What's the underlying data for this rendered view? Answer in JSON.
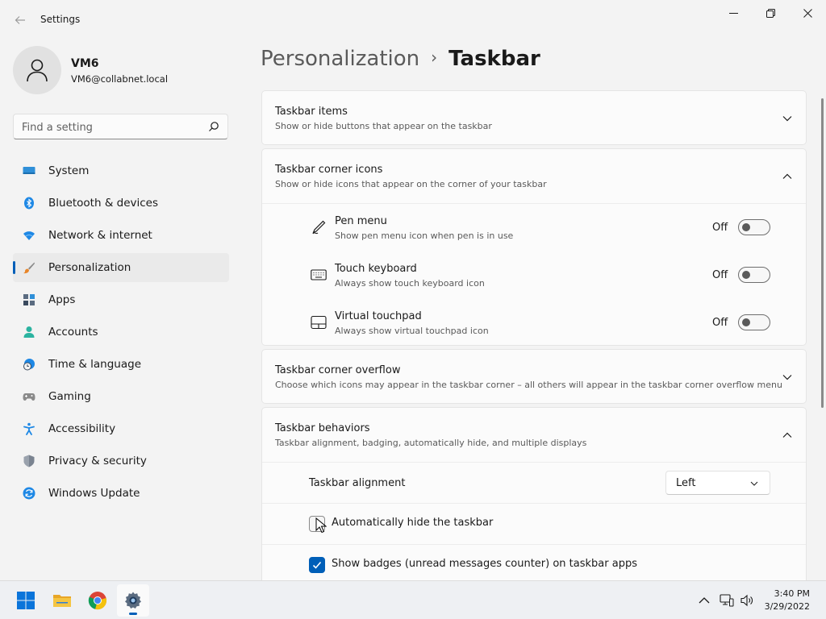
{
  "window": {
    "title": "Settings",
    "back_icon": "back-arrow-icon",
    "controls": [
      "minimize-icon",
      "restore-icon",
      "close-icon"
    ]
  },
  "profile": {
    "name": "VM6",
    "email": "VM6@collabnet.local"
  },
  "search": {
    "placeholder": "Find a setting",
    "value": ""
  },
  "sidebar": {
    "active": "Personalization",
    "items": [
      {
        "label": "System",
        "icon": "system-icon"
      },
      {
        "label": "Bluetooth & devices",
        "icon": "bluetooth-icon"
      },
      {
        "label": "Network & internet",
        "icon": "wifi-icon"
      },
      {
        "label": "Personalization",
        "icon": "brush-icon"
      },
      {
        "label": "Apps",
        "icon": "apps-icon"
      },
      {
        "label": "Accounts",
        "icon": "person-icon"
      },
      {
        "label": "Time & language",
        "icon": "clock-globe-icon"
      },
      {
        "label": "Gaming",
        "icon": "gamepad-icon"
      },
      {
        "label": "Accessibility",
        "icon": "accessibility-icon"
      },
      {
        "label": "Privacy & security",
        "icon": "shield-icon"
      },
      {
        "label": "Windows Update",
        "icon": "update-icon"
      }
    ]
  },
  "breadcrumb": {
    "parent": "Personalization",
    "separator": "›",
    "current": "Taskbar"
  },
  "sections": {
    "taskbar_items": {
      "title": "Taskbar items",
      "subtitle": "Show or hide buttons that appear on the taskbar",
      "expanded": false
    },
    "corner_icons": {
      "title": "Taskbar corner icons",
      "subtitle": "Show or hide icons that appear on the corner of your taskbar",
      "expanded": true,
      "rows": [
        {
          "title": "Pen menu",
          "subtitle": "Show pen menu icon when pen is in use",
          "state_label": "Off",
          "icon": "pen-icon"
        },
        {
          "title": "Touch keyboard",
          "subtitle": "Always show touch keyboard icon",
          "state_label": "Off",
          "icon": "keyboard-icon"
        },
        {
          "title": "Virtual touchpad",
          "subtitle": "Always show virtual touchpad icon",
          "state_label": "Off",
          "icon": "touchpad-icon"
        }
      ]
    },
    "corner_overflow": {
      "title": "Taskbar corner overflow",
      "subtitle": "Choose which icons may appear in the taskbar corner – all others will appear in the taskbar corner overflow menu",
      "expanded": false
    },
    "behaviors": {
      "title": "Taskbar behaviors",
      "subtitle": "Taskbar alignment, badging, automatically hide, and multiple displays",
      "expanded": true,
      "alignment": {
        "label": "Taskbar alignment",
        "value": "Left"
      },
      "auto_hide": {
        "label": "Automatically hide the taskbar",
        "checked": false
      },
      "badges": {
        "label": "Show badges (unread messages counter) on taskbar apps",
        "checked": true
      }
    }
  },
  "taskbar": {
    "apps": [
      "start-icon",
      "file-explorer-icon",
      "chrome-icon",
      "settings-icon"
    ],
    "active_app": "settings-icon",
    "tray": [
      "chevron-up-icon",
      "network-icon",
      "volume-icon"
    ],
    "time": "3:40 PM",
    "date": "3/29/2022"
  },
  "colors": {
    "accent": "#005fb8",
    "background": "#f3f3f3",
    "card": "#fbfbfb"
  }
}
